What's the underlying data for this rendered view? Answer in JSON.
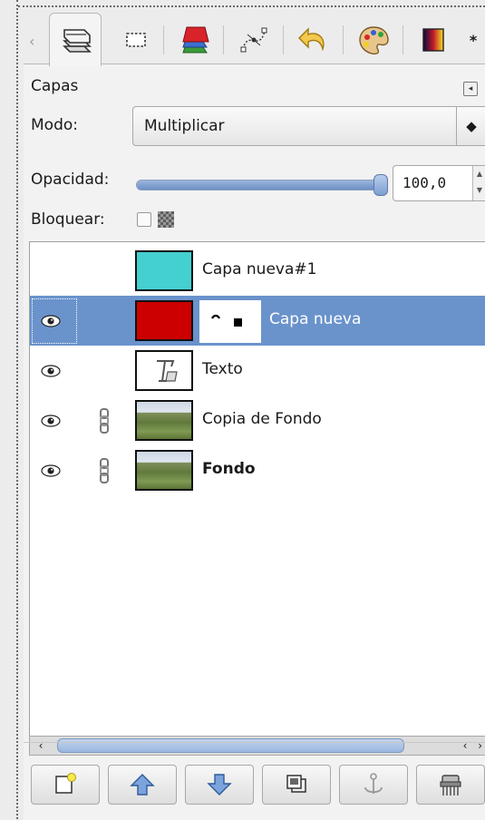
{
  "tabs": {
    "left_arrow": "‹",
    "items": [
      {
        "icon": "layers-icon"
      },
      {
        "icon": "channels-icon"
      },
      {
        "icon": "paths-icon"
      },
      {
        "icon": "undo-history-icon"
      },
      {
        "icon": "palette-icon"
      },
      {
        "icon": "gradient-icon"
      }
    ]
  },
  "dock": {
    "title": "Capas",
    "menu_icon": "dock-menu-icon"
  },
  "mode": {
    "label": "Modo:",
    "value": "Multiplicar",
    "arrow": "◆"
  },
  "opacity": {
    "label": "Opacidad:",
    "value": "100,0",
    "level": 1.0
  },
  "lock": {
    "label": "Bloquear:",
    "pixels_checked": false
  },
  "layers": [
    {
      "name": "Capa nueva#1",
      "visible": false,
      "linked": false,
      "thumb_color": "#44cfd0",
      "bold": false,
      "selected": false
    },
    {
      "name": "Capa nueva",
      "visible": true,
      "linked": false,
      "thumb_color": "#cc0000",
      "has_mask": true,
      "bold": false,
      "selected": true
    },
    {
      "name": "Texto",
      "visible": true,
      "linked": false,
      "thumb": "text-layer-icon",
      "bold": false,
      "selected": false
    },
    {
      "name": "Copia de Fondo",
      "visible": true,
      "linked": true,
      "thumb": "landscape-photo",
      "bold": false,
      "selected": false
    },
    {
      "name": "Fondo",
      "visible": true,
      "linked": true,
      "thumb": "landscape-photo",
      "bold": true,
      "selected": false
    }
  ],
  "scrollbar": {
    "left": "‹",
    "right": "‹ ›"
  },
  "buttons": [
    {
      "icon": "new-layer-icon"
    },
    {
      "icon": "raise-layer-icon"
    },
    {
      "icon": "lower-layer-icon"
    },
    {
      "icon": "duplicate-layer-icon"
    },
    {
      "icon": "anchor-layer-icon"
    },
    {
      "icon": "delete-layer-icon"
    }
  ],
  "colors": {
    "selection": "#6a93cc",
    "cyan_layer": "#44cfd0",
    "red_layer": "#cc0000"
  }
}
